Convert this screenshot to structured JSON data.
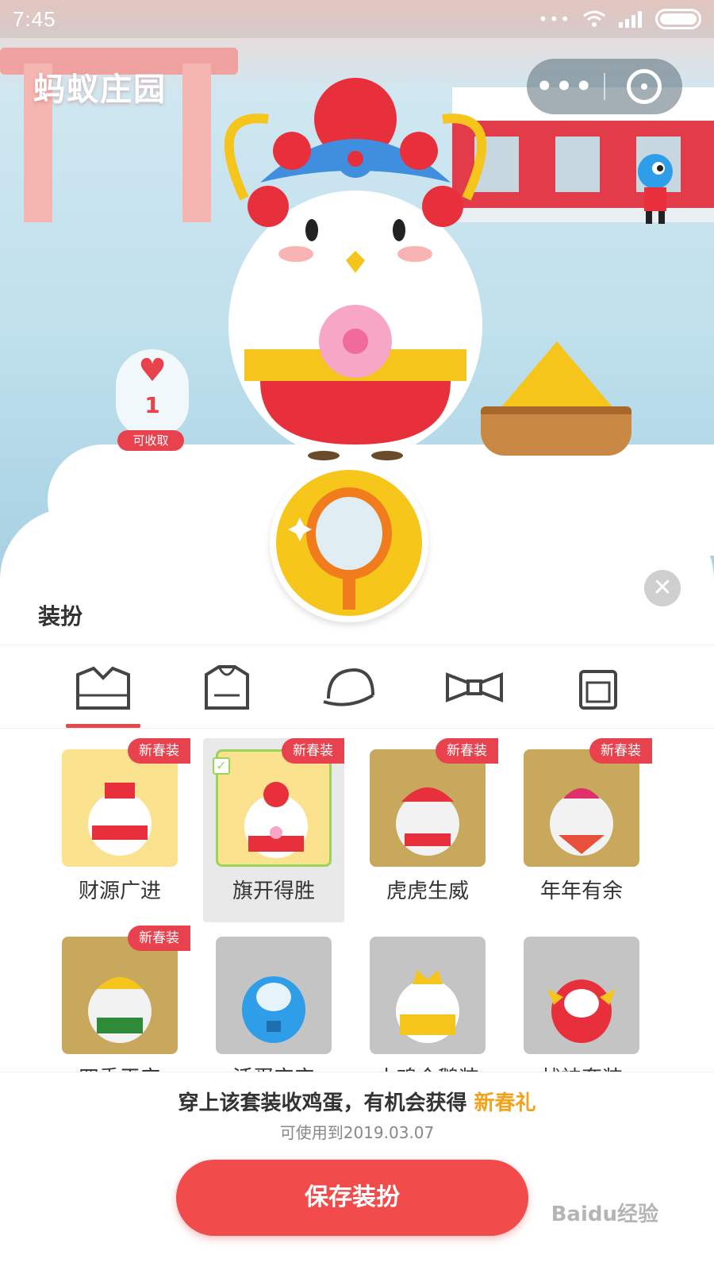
{
  "status_bar": {
    "time": "7:45",
    "dots": "•••"
  },
  "header": {
    "app_title": "蚂蚁庄园",
    "more_label": "•••"
  },
  "scene": {
    "heart_count": "1",
    "collect_label": "可收取"
  },
  "panel": {
    "title": "装扮",
    "tabs": [
      {
        "icon": "shirt-icon"
      },
      {
        "icon": "hoodie-icon"
      },
      {
        "icon": "cap-icon"
      },
      {
        "icon": "bowtie-icon"
      },
      {
        "icon": "bag-icon"
      }
    ],
    "active_tab_index": 0
  },
  "outfits": [
    {
      "name": "财源广进",
      "badge": "新春装",
      "style": "yellow",
      "selected": false
    },
    {
      "name": "旗开得胜",
      "badge": "新春装",
      "style": "yellow",
      "selected": true
    },
    {
      "name": "虎虎生威",
      "badge": "新春装",
      "style": "olive",
      "selected": false
    },
    {
      "name": "年年有余",
      "badge": "新春装",
      "style": "olive",
      "selected": false
    },
    {
      "name": "四季平安",
      "badge": "新春装",
      "style": "olive",
      "selected": false
    },
    {
      "name": "活蛋宝宝",
      "badge": "",
      "style": "grey",
      "selected": false
    },
    {
      "name": "小鸡企鹅装",
      "badge": "",
      "style": "grey",
      "selected": false
    },
    {
      "name": "战神套装",
      "badge": "",
      "style": "grey",
      "selected": false
    }
  ],
  "footer": {
    "promo_text": "穿上该套装收鸡蛋，有机会获得",
    "promo_highlight": "新春礼",
    "valid_until": "可使用到2019.03.07",
    "save_label": "保存装扮",
    "watermark": "Baidu经验"
  },
  "colors": {
    "accent": "#f24b4b",
    "highlight": "#f3a21c",
    "selected_border": "#9bd45a"
  }
}
